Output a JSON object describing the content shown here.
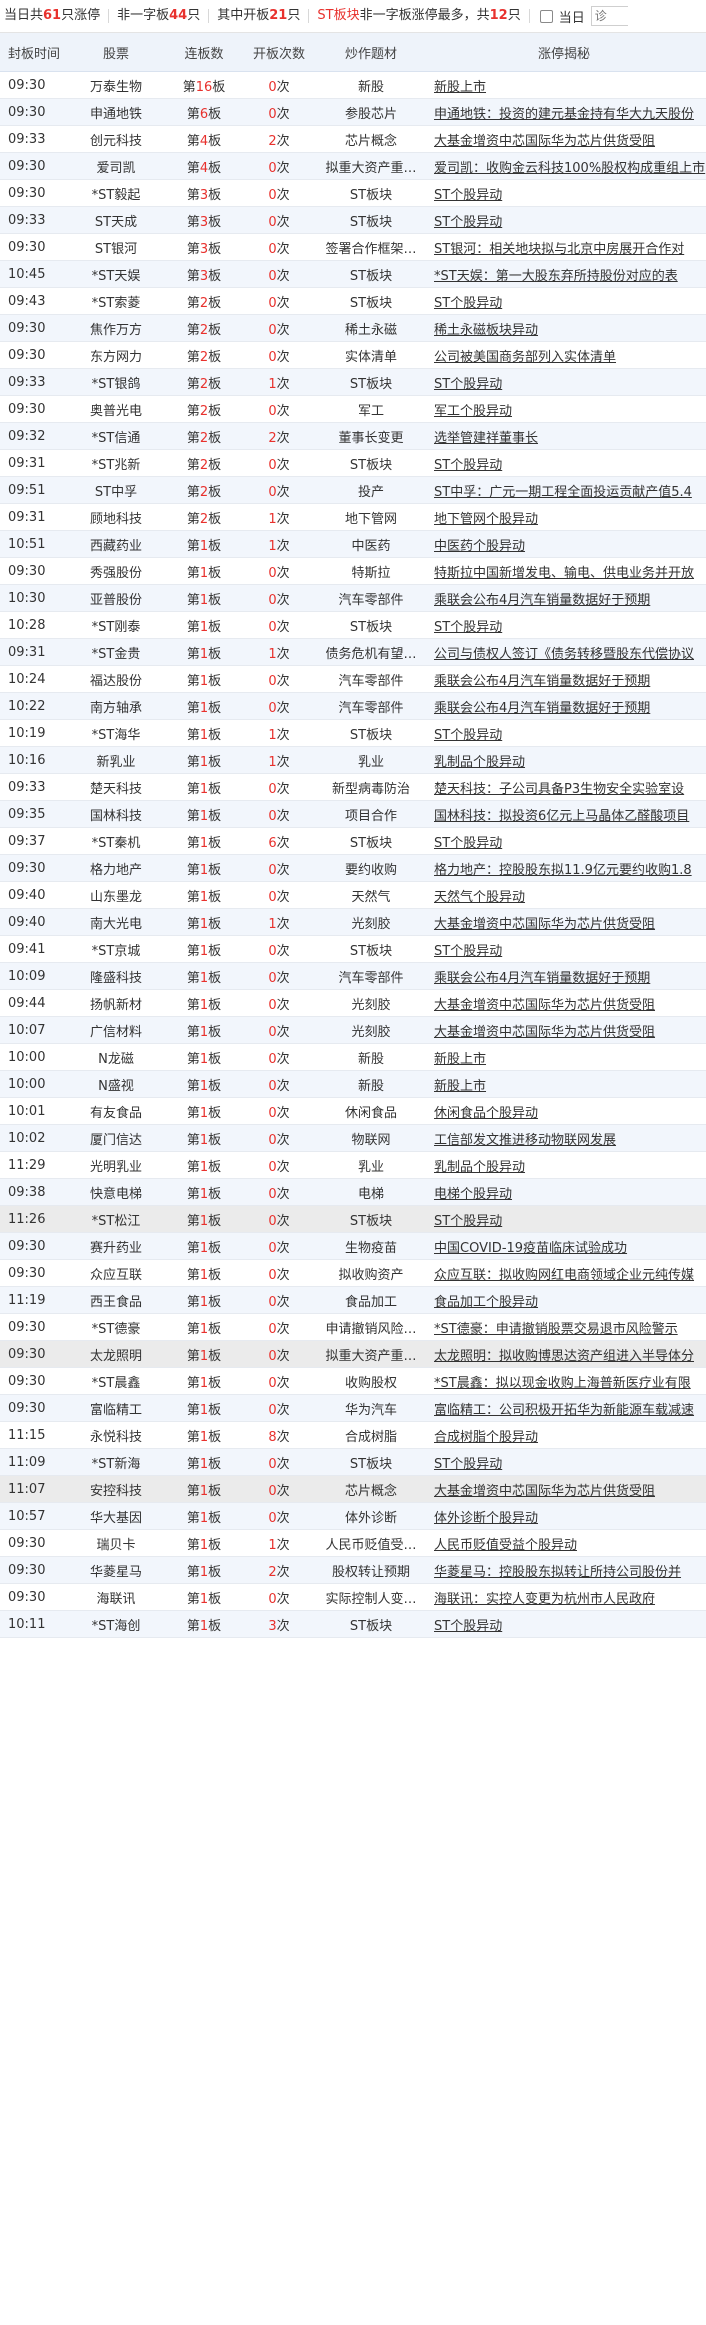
{
  "summary": {
    "total_prefix": "当日共",
    "total_count": "61",
    "total_suffix": "只涨停",
    "noone_prefix": "非一字板",
    "noone_count": "44",
    "noone_suffix": "只",
    "open_prefix": "其中开板",
    "open_count": "21",
    "open_suffix": "只",
    "st_label": "ST板块",
    "st_mid": "非一字板涨停最多，共",
    "st_count": "12",
    "st_suffix": "只",
    "checkbox_label": "当日",
    "search_placeholder": "诊"
  },
  "table": {
    "headers": [
      "封板时间",
      "股票",
      "连板数",
      "开板次数",
      "炒作题材",
      "涨停揭秘"
    ],
    "rows": [
      {
        "time": "09:30",
        "stock": "万泰生物",
        "board": "16",
        "open": "0",
        "concept": "新股",
        "reason": "新股上市"
      },
      {
        "time": "09:30",
        "stock": "申通地铁",
        "board": "6",
        "open": "0",
        "concept": "参股芯片",
        "reason": "申通地铁：投资的建元基金持有华大九天股份"
      },
      {
        "time": "09:33",
        "stock": "创元科技",
        "board": "4",
        "open": "2",
        "concept": "芯片概念",
        "reason": "大基金增资中芯国际华为芯片供货受阻"
      },
      {
        "time": "09:30",
        "stock": "爱司凯",
        "board": "4",
        "open": "0",
        "concept": "拟重大资产重…",
        "reason": "爱司凯：收购金云科技100%股权构成重组上市"
      },
      {
        "time": "09:30",
        "stock": "*ST毅起",
        "board": "3",
        "open": "0",
        "concept": "ST板块",
        "reason": "ST个股异动"
      },
      {
        "time": "09:33",
        "stock": "ST天成",
        "board": "3",
        "open": "0",
        "concept": "ST板块",
        "reason": "ST个股异动"
      },
      {
        "time": "09:30",
        "stock": "ST银河",
        "board": "3",
        "open": "0",
        "concept": "签署合作框架…",
        "reason": "ST银河：相关地块拟与北京中房展开合作对"
      },
      {
        "time": "10:45",
        "stock": "*ST天娱",
        "board": "3",
        "open": "0",
        "concept": "ST板块",
        "reason": "*ST天娱：第一大股东弃所持股份对应的表"
      },
      {
        "time": "09:43",
        "stock": "*ST索菱",
        "board": "2",
        "open": "0",
        "concept": "ST板块",
        "reason": "ST个股异动"
      },
      {
        "time": "09:30",
        "stock": "焦作万方",
        "board": "2",
        "open": "0",
        "concept": "稀土永磁",
        "reason": "稀土永磁板块异动"
      },
      {
        "time": "09:30",
        "stock": "东方网力",
        "board": "2",
        "open": "0",
        "concept": "实体清单",
        "reason": "公司被美国商务部列入实体清单"
      },
      {
        "time": "09:33",
        "stock": "*ST银鸽",
        "board": "2",
        "open": "1",
        "concept": "ST板块",
        "reason": "ST个股异动"
      },
      {
        "time": "09:30",
        "stock": "奥普光电",
        "board": "2",
        "open": "0",
        "concept": "军工",
        "reason": "军工个股异动"
      },
      {
        "time": "09:32",
        "stock": "*ST信通",
        "board": "2",
        "open": "2",
        "concept": "董事长变更",
        "reason": "选举管建祥董事长"
      },
      {
        "time": "09:31",
        "stock": "*ST兆新",
        "board": "2",
        "open": "0",
        "concept": "ST板块",
        "reason": "ST个股异动"
      },
      {
        "time": "09:51",
        "stock": "ST中孚",
        "board": "2",
        "open": "0",
        "concept": "投产",
        "reason": "ST中孚：广元一期工程全面投运贡献产值5.4"
      },
      {
        "time": "09:31",
        "stock": "顾地科技",
        "board": "2",
        "open": "1",
        "concept": "地下管网",
        "reason": "地下管网个股异动"
      },
      {
        "time": "10:51",
        "stock": "西藏药业",
        "board": "1",
        "open": "1",
        "concept": "中医药",
        "reason": "中医药个股异动"
      },
      {
        "time": "09:30",
        "stock": "秀强股份",
        "board": "1",
        "open": "0",
        "concept": "特斯拉",
        "reason": "特斯拉中国新增发电、输电、供电业务并开放"
      },
      {
        "time": "10:30",
        "stock": "亚普股份",
        "board": "1",
        "open": "0",
        "concept": "汽车零部件",
        "reason": "乘联会公布4月汽车销量数据好于预期"
      },
      {
        "time": "10:28",
        "stock": "*ST刚泰",
        "board": "1",
        "open": "0",
        "concept": "ST板块",
        "reason": "ST个股异动"
      },
      {
        "time": "09:31",
        "stock": "*ST金贵",
        "board": "1",
        "open": "1",
        "concept": "债务危机有望…",
        "reason": "公司与债权人签订《债务转移暨股东代偿协议"
      },
      {
        "time": "10:24",
        "stock": "福达股份",
        "board": "1",
        "open": "0",
        "concept": "汽车零部件",
        "reason": "乘联会公布4月汽车销量数据好于预期"
      },
      {
        "time": "10:22",
        "stock": "南方轴承",
        "board": "1",
        "open": "0",
        "concept": "汽车零部件",
        "reason": "乘联会公布4月汽车销量数据好于预期"
      },
      {
        "time": "10:19",
        "stock": "*ST海华",
        "board": "1",
        "open": "1",
        "concept": "ST板块",
        "reason": "ST个股异动"
      },
      {
        "time": "10:16",
        "stock": "新乳业",
        "board": "1",
        "open": "1",
        "concept": "乳业",
        "reason": "乳制品个股异动"
      },
      {
        "time": "09:33",
        "stock": "楚天科技",
        "board": "1",
        "open": "0",
        "concept": "新型病毒防治",
        "reason": "楚天科技：子公司具备P3生物安全实验室设"
      },
      {
        "time": "09:35",
        "stock": "国林科技",
        "board": "1",
        "open": "0",
        "concept": "项目合作",
        "reason": "国林科技：拟投资6亿元上马晶体乙醛酸项目"
      },
      {
        "time": "09:37",
        "stock": "*ST秦机",
        "board": "1",
        "open": "6",
        "concept": "ST板块",
        "reason": "ST个股异动"
      },
      {
        "time": "09:30",
        "stock": "格力地产",
        "board": "1",
        "open": "0",
        "concept": "要约收购",
        "reason": "格力地产：控股股东拟11.9亿元要约收购1.8"
      },
      {
        "time": "09:40",
        "stock": "山东墨龙",
        "board": "1",
        "open": "0",
        "concept": "天然气",
        "reason": "天然气个股异动"
      },
      {
        "time": "09:40",
        "stock": "南大光电",
        "board": "1",
        "open": "1",
        "concept": "光刻胶",
        "reason": "大基金增资中芯国际华为芯片供货受阻"
      },
      {
        "time": "09:41",
        "stock": "*ST京城",
        "board": "1",
        "open": "0",
        "concept": "ST板块",
        "reason": "ST个股异动"
      },
      {
        "time": "10:09",
        "stock": "隆盛科技",
        "board": "1",
        "open": "0",
        "concept": "汽车零部件",
        "reason": "乘联会公布4月汽车销量数据好于预期"
      },
      {
        "time": "09:44",
        "stock": "扬帆新材",
        "board": "1",
        "open": "0",
        "concept": "光刻胶",
        "reason": "大基金增资中芯国际华为芯片供货受阻"
      },
      {
        "time": "10:07",
        "stock": "广信材料",
        "board": "1",
        "open": "0",
        "concept": "光刻胶",
        "reason": "大基金增资中芯国际华为芯片供货受阻"
      },
      {
        "time": "10:00",
        "stock": "N龙磁",
        "board": "1",
        "open": "0",
        "concept": "新股",
        "reason": "新股上市"
      },
      {
        "time": "10:00",
        "stock": "N盛视",
        "board": "1",
        "open": "0",
        "concept": "新股",
        "reason": "新股上市"
      },
      {
        "time": "10:01",
        "stock": "有友食品",
        "board": "1",
        "open": "0",
        "concept": "休闲食品",
        "reason": "休闲食品个股异动"
      },
      {
        "time": "10:02",
        "stock": "厦门信达",
        "board": "1",
        "open": "0",
        "concept": "物联网",
        "reason": "工信部发文推进移动物联网发展"
      },
      {
        "time": "11:29",
        "stock": "光明乳业",
        "board": "1",
        "open": "0",
        "concept": "乳业",
        "reason": "乳制品个股异动"
      },
      {
        "time": "09:38",
        "stock": "快意电梯",
        "board": "1",
        "open": "0",
        "concept": "电梯",
        "reason": "电梯个股异动"
      },
      {
        "time": "11:26",
        "stock": "*ST松江",
        "board": "1",
        "open": "0",
        "concept": "ST板块",
        "reason": "ST个股异动",
        "gray": true
      },
      {
        "time": "09:30",
        "stock": "赛升药业",
        "board": "1",
        "open": "0",
        "concept": "生物疫苗",
        "reason": "中国COVID-19疫苗临床试验成功"
      },
      {
        "time": "09:30",
        "stock": "众应互联",
        "board": "1",
        "open": "0",
        "concept": "拟收购资产",
        "reason": "众应互联：拟收购网红电商领域企业元纯传媒"
      },
      {
        "time": "11:19",
        "stock": "西王食品",
        "board": "1",
        "open": "0",
        "concept": "食品加工",
        "reason": "食品加工个股异动"
      },
      {
        "time": "09:30",
        "stock": "*ST德豪",
        "board": "1",
        "open": "0",
        "concept": "申请撤销风险…",
        "reason": "*ST德豪：申请撤销股票交易退市风险警示"
      },
      {
        "time": "09:30",
        "stock": "太龙照明",
        "board": "1",
        "open": "0",
        "concept": "拟重大资产重…",
        "reason": "太龙照明：拟收购博思达资产组进入半导体分",
        "gray": true
      },
      {
        "time": "09:30",
        "stock": "*ST晨鑫",
        "board": "1",
        "open": "0",
        "concept": "收购股权",
        "reason": "*ST晨鑫：拟以现金收购上海普新医疗业有限"
      },
      {
        "time": "09:30",
        "stock": "富临精工",
        "board": "1",
        "open": "0",
        "concept": "华为汽车",
        "reason": "富临精工：公司积极开拓华为新能源车载减速"
      },
      {
        "time": "11:15",
        "stock": "永悦科技",
        "board": "1",
        "open": "8",
        "concept": "合成树脂",
        "reason": "合成树脂个股异动"
      },
      {
        "time": "11:09",
        "stock": "*ST新海",
        "board": "1",
        "open": "0",
        "concept": "ST板块",
        "reason": "ST个股异动"
      },
      {
        "time": "11:07",
        "stock": "安控科技",
        "board": "1",
        "open": "0",
        "concept": "芯片概念",
        "reason": "大基金增资中芯国际华为芯片供货受阻",
        "gray": true
      },
      {
        "time": "10:57",
        "stock": "华大基因",
        "board": "1",
        "open": "0",
        "concept": "体外诊断",
        "reason": "体外诊断个股异动"
      },
      {
        "time": "09:30",
        "stock": "瑞贝卡",
        "board": "1",
        "open": "1",
        "concept": "人民币贬值受…",
        "reason": "人民币贬值受益个股异动"
      },
      {
        "time": "09:30",
        "stock": "华菱星马",
        "board": "1",
        "open": "2",
        "concept": "股权转让预期",
        "reason": "华菱星马：控股股东拟转让所持公司股份并"
      },
      {
        "time": "09:30",
        "stock": "海联讯",
        "board": "1",
        "open": "0",
        "concept": "实际控制人变…",
        "reason": "海联讯：实控人变更为杭州市人民政府"
      },
      {
        "time": "10:11",
        "stock": "*ST海创",
        "board": "1",
        "open": "3",
        "concept": "ST板块",
        "reason": "ST个股异动"
      }
    ]
  },
  "colors": {
    "accent_red": "#e8312d",
    "header_bg": "#eef3fa",
    "zebra_bg": "#f2f6fc",
    "highlight_gray": "#ebebeb"
  }
}
